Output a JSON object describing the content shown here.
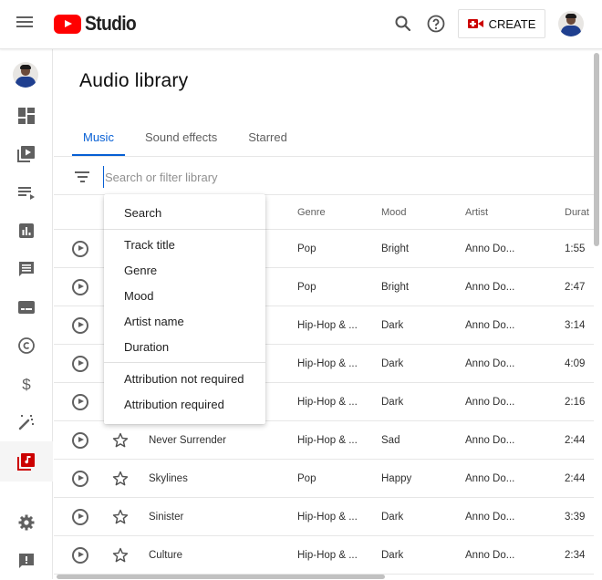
{
  "header": {
    "logo_text": "Studio",
    "create_label": "CREATE",
    "icons": [
      "menu-icon",
      "search-icon",
      "help-icon",
      "create-video-icon",
      "account-avatar"
    ]
  },
  "sidebar": {
    "items": [
      {
        "name": "channel-avatar"
      },
      {
        "name": "dashboard-icon",
        "label": "Dashboard"
      },
      {
        "name": "content-icon",
        "label": "Content"
      },
      {
        "name": "playlists-icon",
        "label": "Playlists"
      },
      {
        "name": "analytics-icon",
        "label": "Analytics"
      },
      {
        "name": "comments-icon",
        "label": "Comments"
      },
      {
        "name": "subtitles-icon",
        "label": "Subtitles"
      },
      {
        "name": "copyright-icon",
        "label": "Copyright"
      },
      {
        "name": "monetization-icon",
        "label": "Earn"
      },
      {
        "name": "customization-icon",
        "label": "Customization"
      },
      {
        "name": "audio-library-icon",
        "label": "Audio library",
        "active": true
      },
      {
        "name": "settings-icon",
        "label": "Settings"
      },
      {
        "name": "feedback-icon",
        "label": "Send feedback"
      }
    ],
    "active_color": "#cc0000"
  },
  "main": {
    "title": "Audio library",
    "tabs": [
      {
        "label": "Music",
        "active": true
      },
      {
        "label": "Sound effects",
        "active": false
      },
      {
        "label": "Starred",
        "active": false
      }
    ],
    "search": {
      "placeholder": "Search or filter library",
      "value": ""
    },
    "columns": [
      "Genre",
      "Mood",
      "Artist",
      "Durat"
    ],
    "rows": [
      {
        "title": "",
        "genre": "Pop",
        "mood": "Bright",
        "artist": "Anno Do...",
        "duration": "1:55"
      },
      {
        "title": "",
        "genre": "Pop",
        "mood": "Bright",
        "artist": "Anno Do...",
        "duration": "2:47"
      },
      {
        "title": "",
        "genre": "Hip-Hop & ...",
        "mood": "Dark",
        "artist": "Anno Do...",
        "duration": "3:14"
      },
      {
        "title": "",
        "genre": "Hip-Hop & ...",
        "mood": "Dark",
        "artist": "Anno Do...",
        "duration": "4:09"
      },
      {
        "title": "",
        "genre": "Hip-Hop & ...",
        "mood": "Dark",
        "artist": "Anno Do...",
        "duration": "2:16"
      },
      {
        "title": "Never Surrender",
        "genre": "Hip-Hop & ...",
        "mood": "Sad",
        "artist": "Anno Do...",
        "duration": "2:44"
      },
      {
        "title": "Skylines",
        "genre": "Pop",
        "mood": "Happy",
        "artist": "Anno Do...",
        "duration": "2:44"
      },
      {
        "title": "Sinister",
        "genre": "Hip-Hop & ...",
        "mood": "Dark",
        "artist": "Anno Do...",
        "duration": "3:39"
      },
      {
        "title": "Culture",
        "genre": "Hip-Hop & ...",
        "mood": "Dark",
        "artist": "Anno Do...",
        "duration": "2:34"
      }
    ],
    "accent_color": "#065fd4"
  },
  "filter_menu": {
    "header": "Search",
    "groups": [
      [
        "Track title",
        "Genre",
        "Mood",
        "Artist name",
        "Duration"
      ],
      [
        "Attribution not required",
        "Attribution required"
      ]
    ]
  }
}
